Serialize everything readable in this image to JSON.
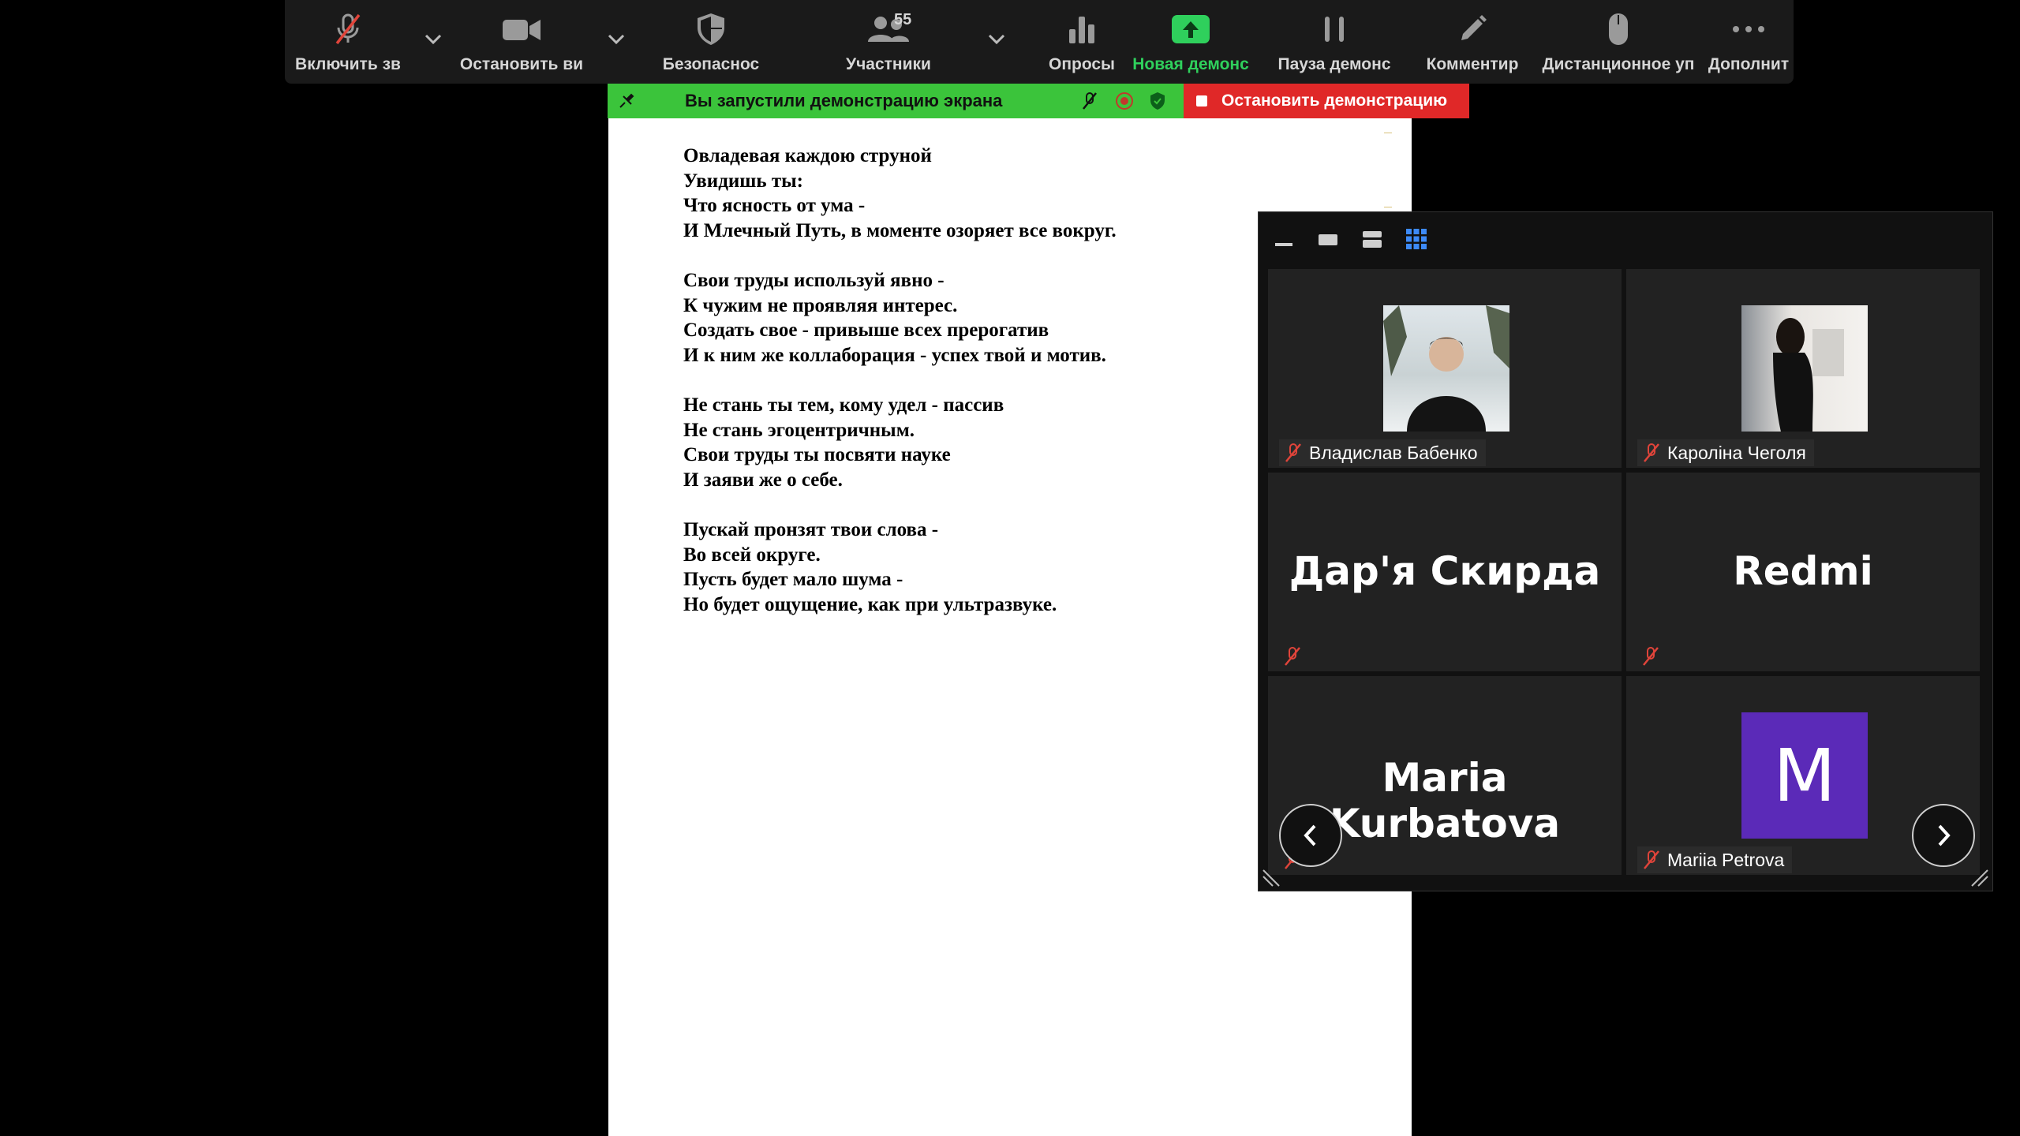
{
  "toolbar": {
    "audio_label": "Включить зв",
    "video_label": "Остановить ви",
    "security_label": "Безопаснос",
    "participants_label": "Участники",
    "participants_count": "55",
    "polls_label": "Опросы",
    "new_share_label": "Новая демонс",
    "pause_share_label": "Пауза демонс",
    "annotate_label": "Комментир",
    "remote_control_label": "Дистанционное уп",
    "more_label": "Дополнит"
  },
  "share_bar": {
    "status": "Вы запустили демонстрацию экрана",
    "stop_label": "Остановить демонстрацию"
  },
  "document": {
    "stanzas": [
      [
        "Овладевая каждою струной",
        "Увидишь ты:",
        "Что ясность от ума -",
        "И Млечный Путь, в моменте озоряет все вокруг."
      ],
      [
        "Свои труды используй явно -",
        "К чужим не проявляя интерес.",
        "Создать свое - привыше всех прерогатив",
        "И к ним же коллаборация - успех твой и мотив."
      ],
      [
        "Не стань ты тем, кому удел - пассив",
        "Не стань эгоцентричным.",
        "Свои труды ты посвяти науке",
        "И заяви же о себе."
      ],
      [
        "Пускай пронзят твои слова -",
        "Во всей округе.",
        "Пусть будет мало шума -",
        "Но будет ощущение, как при ультразвуке."
      ]
    ]
  },
  "gallery": {
    "participants": [
      {
        "name": "Владислав Бабенко",
        "display": "photo"
      },
      {
        "name": "Кароліна Чеголя",
        "display": "photo"
      },
      {
        "name": "Дар'я Скирда",
        "display": "name"
      },
      {
        "name": "Redmi",
        "display": "name"
      },
      {
        "name": "Maria Kurbatova",
        "display": "name"
      },
      {
        "name": "Mariia Petrova",
        "display": "avatar",
        "avatar_letter": "M",
        "avatar_color": "#5b2ab8"
      }
    ]
  },
  "colors": {
    "share_green": "#3bc43b",
    "stop_red": "#e02828",
    "new_share_green": "#2fd05c",
    "muted_red": "#e0443a",
    "active_view_blue": "#3d8af7"
  },
  "icons": {
    "audio": "mic-muted-icon",
    "video": "camera-icon",
    "security": "shield-icon",
    "participants": "people-icon",
    "polls": "bar-chart-icon",
    "new_share": "share-screen-up-icon",
    "pause": "pause-icon",
    "annotate": "pen-icon",
    "remote": "mouse-icon",
    "more": "ellipsis-icon"
  }
}
